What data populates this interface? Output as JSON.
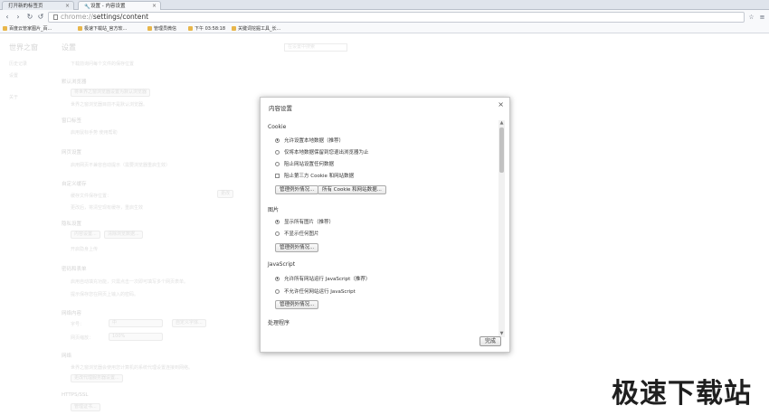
{
  "tabs": [
    {
      "label": "打开新的标签页",
      "active": false
    },
    {
      "label": "设置 - 内容设置",
      "active": true
    }
  ],
  "toolbar": {
    "url_scheme": "chrome://",
    "url_path": "settings/content"
  },
  "bookmarks": [
    "百度云管家图片_百...",
    "极速下载站_官方软...",
    "管理员微信",
    "下午 03:58:18",
    "关键词挖掘工具_长..."
  ],
  "background": {
    "sidebar_title": "世界之窗",
    "sidebar_items": [
      "历史记录",
      "设置",
      "关于"
    ],
    "page_title": "设置",
    "search_placeholder": "在设置中搜索",
    "lines": [
      "下载前询问每个文件的保存位置",
      "默认浏览器",
      "将世界之窗浏览器设置为默认浏览器",
      "世界之窗浏览器目前不是默认浏览器。",
      "窗口标签",
      "启用鼠标手势 使用帮助",
      "网页设置",
      "启用网页不兼容自动提示（需要浏览器重启生效）",
      "自定义缓存",
      "缓存文件保存位置：",
      "更改",
      "更改后，将清空现有缓存，重启生效",
      "隐私设置",
      "内容设置...",
      "清除浏览数据...",
      "开启隐身上传",
      "密码和表单",
      "启用自动填充功能，只需点击一次即可填写多个网页表单。",
      "提示保存您在网页上输入的密码。",
      "网络内容",
      "字号：",
      "中",
      "自定义字体...",
      "网页缩放：",
      "100%",
      "网络",
      "世界之窗浏览器会使用您计算机的系统代理设置连接到网络。",
      "更改代理服务器设置...",
      "HTTPS/SSL",
      "管理证书..."
    ]
  },
  "dialog": {
    "title": "内容设置",
    "sections": {
      "cookie": {
        "title": "Cookie",
        "options": [
          "允许设置本地数据（推荐）",
          "仅将本地数据保留到您退出浏览器为止",
          "阻止网站设置任何数据",
          "阻止第三方 Cookie 和网站数据"
        ],
        "btn_exceptions": "管理例外情况...",
        "btn_all": "所有 Cookie 和网站数据..."
      },
      "images": {
        "title": "图片",
        "options": [
          "显示所有图片（推荐）",
          "不显示任何图片"
        ],
        "btn_exceptions": "管理例外情况..."
      },
      "javascript": {
        "title": "JavaScript",
        "options": [
          "允许所有网站运行 JavaScript（推荐）",
          "不允许任何网站运行 JavaScript"
        ],
        "btn_exceptions": "管理例外情况..."
      },
      "handlers": {
        "title": "处理程序"
      }
    },
    "done_label": "完成"
  },
  "watermark": "极速下载站"
}
